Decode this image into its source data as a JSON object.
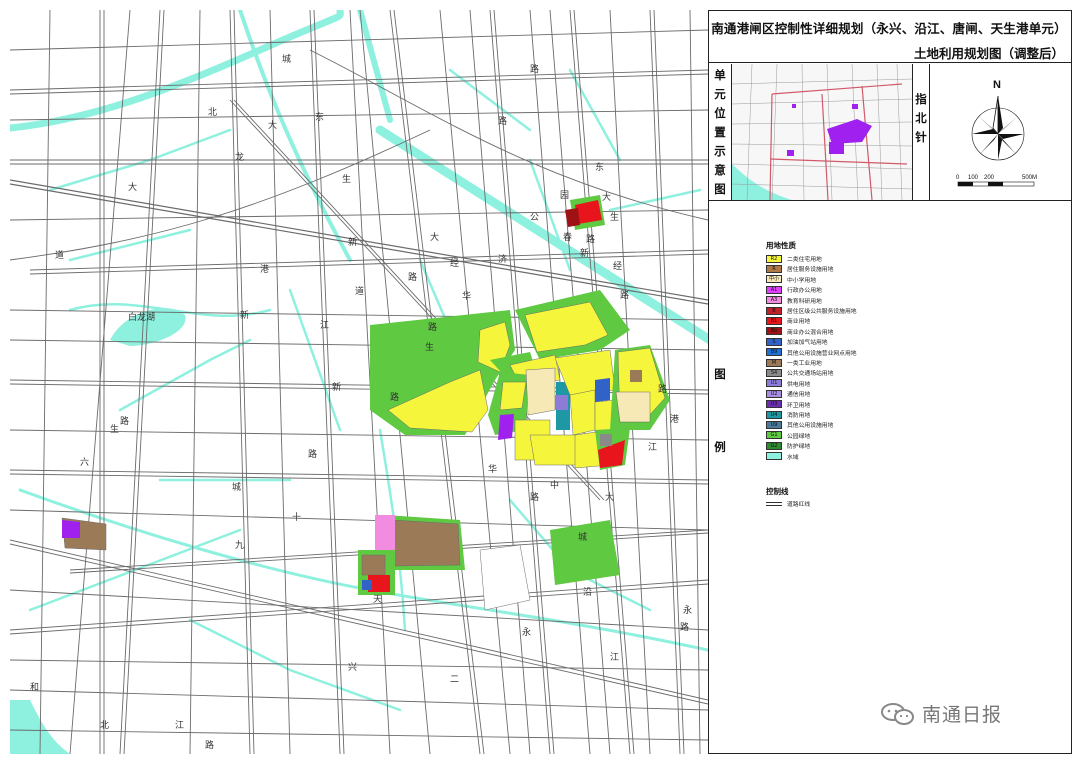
{
  "title": {
    "line1": "南通港闸区控制性详细规划（永兴、沿江、唐闸、天生港单元）",
    "line2": "土地利用规划图（调整后）"
  },
  "side_labels": {
    "location_map": "单元位置示意图",
    "north_arrow": "指北针",
    "legend": "图例"
  },
  "compass": {
    "north": "N",
    "scale_ticks": [
      "0",
      "100",
      "200",
      "500M"
    ]
  },
  "legend": {
    "title": "用地性质",
    "items": [
      {
        "code": "R2",
        "label": "二类住宅用地",
        "color": "#f5f53c"
      },
      {
        "code": "R",
        "label": "居住服务设施用地",
        "color": "#b07a48"
      },
      {
        "code": "中小",
        "label": "中小学用地",
        "color": "#f7e9b5"
      },
      {
        "code": "A1",
        "label": "行政办公用地",
        "color": "#e040fb"
      },
      {
        "code": "A3",
        "label": "教育科研用地",
        "color": "#f28ce0"
      },
      {
        "code": "B",
        "label": "居住区级公共服务设施用地",
        "color": "#c0202a"
      },
      {
        "code": "B1",
        "label": "商业用地",
        "color": "#e8161c"
      },
      {
        "code": "Bb",
        "label": "商业办公混合用地",
        "color": "#9e1216"
      },
      {
        "code": "S",
        "label": "加油加气站用地",
        "color": "#3062c8"
      },
      {
        "code": "B9",
        "label": "其他公用设施营业网点用地",
        "color": "#1f6fd6"
      },
      {
        "code": "M",
        "label": "一类工业用地",
        "color": "#9b7a57"
      },
      {
        "code": "S4",
        "label": "公共交通场站用地",
        "color": "#8a8a8a"
      },
      {
        "code": "U1",
        "label": "供电用地",
        "color": "#8c7cd8"
      },
      {
        "code": "U2",
        "label": "通信用地",
        "color": "#a68de0"
      },
      {
        "code": "U3",
        "label": "环卫用地",
        "color": "#6a2fb0"
      },
      {
        "code": "U4",
        "label": "消防用地",
        "color": "#1f98a5"
      },
      {
        "code": "U9",
        "label": "其他公用设施用地",
        "color": "#4c7a9a"
      },
      {
        "code": "G1",
        "label": "公园绿地",
        "color": "#5ec941"
      },
      {
        "code": "G2",
        "label": "防护绿地",
        "color": "#2f8a2f"
      },
      {
        "code": "",
        "label": "水域",
        "color": "#8ef0de"
      }
    ],
    "control_title": "控制线",
    "control_items": [
      {
        "label": "道路红线"
      }
    ]
  },
  "map_labels": {
    "roads": [
      "城",
      "北",
      "大",
      "龙",
      "大",
      "道",
      "东",
      "生",
      "新",
      "港",
      "道",
      "华",
      "新",
      "江",
      "济",
      "生",
      "路",
      "路",
      "东",
      "大",
      "园",
      "公",
      "春",
      "路",
      "生",
      "新",
      "经",
      "路",
      "路",
      "六",
      "生",
      "新",
      "城",
      "九",
      "十",
      "路",
      "华",
      "路",
      "中",
      "城",
      "大",
      "永",
      "兴",
      "二",
      "永",
      "和",
      "江",
      "北",
      "路",
      "天",
      "沿",
      "江",
      "路",
      "港",
      "路",
      "江",
      "大",
      "路",
      "路",
      "路",
      "经"
    ],
    "water": [
      "白龙湖"
    ]
  },
  "watermark": {
    "text": "南通日报"
  },
  "colors": {
    "water": "#8ef0de",
    "road": "#ffffff",
    "block_line": "#777777",
    "residential": "#f5f53c",
    "green": "#5ec941",
    "defense_green": "#2f8a2f",
    "brown": "#9b7a57",
    "pink": "#f28ce0",
    "red": "#e8161c",
    "purple": "#a020f0"
  }
}
